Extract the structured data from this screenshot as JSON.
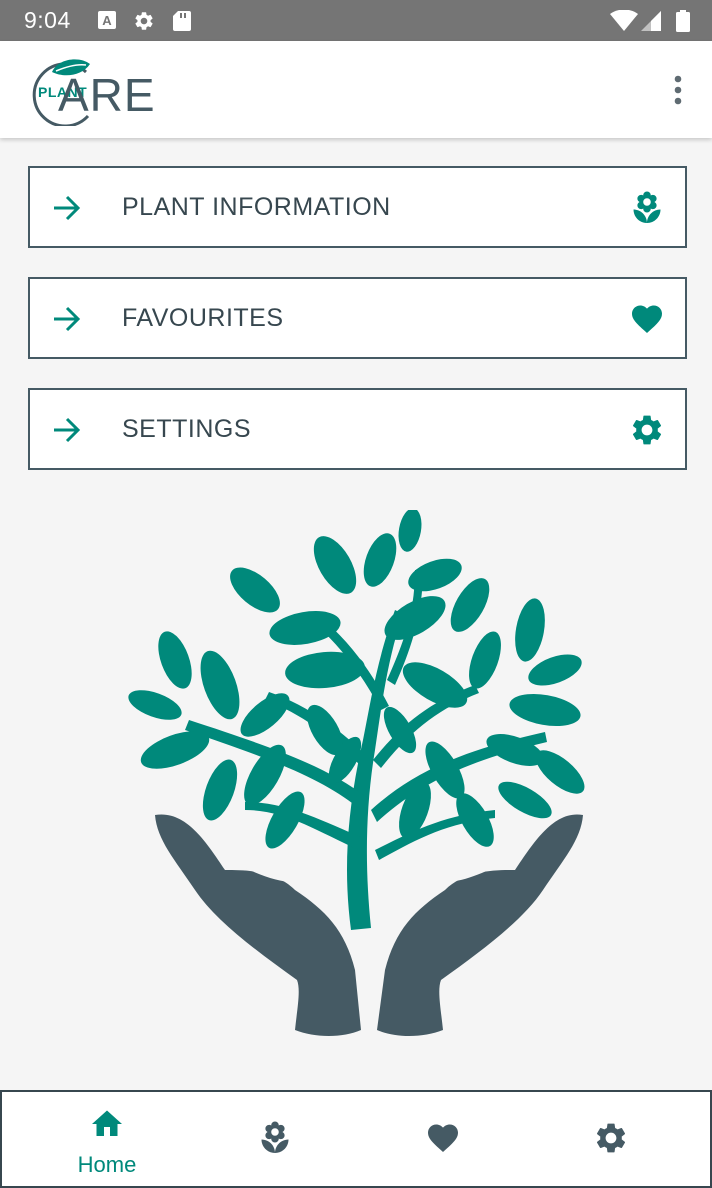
{
  "status_bar": {
    "time": "9:04",
    "icons": [
      "a-icon",
      "gear-icon",
      "sd-card-icon",
      "wifi-icon",
      "signal-icon",
      "battery-icon"
    ]
  },
  "app_bar": {
    "logo_plant": "PLANT",
    "logo_care": "ARE",
    "overflow_icon": "more-vert-icon"
  },
  "menu": [
    {
      "label": "PLANT INFORMATION",
      "icon": "flower-icon"
    },
    {
      "label": "FAVOURITES",
      "icon": "heart-icon"
    },
    {
      "label": "SETTINGS",
      "icon": "gear-icon"
    }
  ],
  "bottom_nav": [
    {
      "label": "Home",
      "icon": "home-icon",
      "selected": true
    },
    {
      "label": "",
      "icon": "flower-icon",
      "selected": false
    },
    {
      "label": "",
      "icon": "heart-icon",
      "selected": false
    },
    {
      "label": "",
      "icon": "gear-icon",
      "selected": false
    }
  ],
  "colors": {
    "accent": "#00897b",
    "dark": "#455a64",
    "status_bar": "#757575"
  }
}
